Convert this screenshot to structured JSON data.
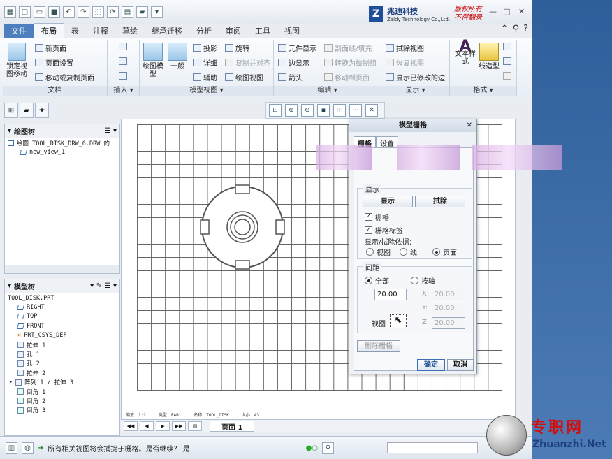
{
  "logo": {
    "mark": "Z",
    "name": "兆迪科技",
    "en": "Zaldy Technology Co.,Ltd.",
    "red1": "版权所有",
    "red2": "不得翻录"
  },
  "tabs": [
    "文件",
    "布局",
    "表",
    "注释",
    "草绘",
    "继承迁移",
    "分析",
    "审阅",
    "工具",
    "视图"
  ],
  "ribbon": {
    "doc": {
      "big": "锁定视图移动",
      "items": [
        "新页面",
        "页面设置",
        "移动或复制页面"
      ],
      "label": "文档"
    },
    "insert": {
      "label": "插入"
    },
    "model": {
      "big1": "绘图模型",
      "big2": "一般",
      "items": [
        "投影",
        "详细",
        "辅助",
        "旋转",
        "复制并对齐",
        "绘图视图"
      ],
      "label": "模型视图"
    },
    "edit": {
      "items": [
        "元件显示",
        "边显示",
        "箭头",
        "剖面线/填充",
        "转换为绘制组",
        "移动到页面"
      ],
      "label": "编辑"
    },
    "display": {
      "items": [
        "拭除视图",
        "恢复视图",
        "显示已修改的边"
      ],
      "label": "显示"
    },
    "format": {
      "big1": "文本样式",
      "big2": "线造型",
      "label": "格式"
    }
  },
  "draw_tree": {
    "title": "绘图树",
    "items": [
      "绘图 TOOL_DISK_DRW_6.DRW 的",
      "new_view_1"
    ]
  },
  "model_tree": {
    "title": "模型树",
    "items": [
      "TOOL_DISK.PRT",
      "RIGHT",
      "TOP",
      "FRONT",
      "PRT_CSYS_DEF",
      "拉伸 1",
      "孔 1",
      "孔 2",
      "拉伸 2",
      "阵列 1 / 拉伸 3",
      "倒角 1",
      "倒角 2",
      "倒角 3"
    ]
  },
  "canvas_footer": [
    "缩放：1:2",
    "类型：FAB1",
    "名称：TOOL_DISK",
    "大小：A3"
  ],
  "page_tab": "页面 1",
  "status_msg": "所有相关视图将会捕捉于栅格。是否继续？   是",
  "dialog": {
    "title": "模型栅格",
    "tab1": "栅格",
    "tab2": "设置",
    "show_legend": "显示",
    "show_btn": "显示",
    "erase_btn": "拭除",
    "grid_chk": "栅格",
    "label_chk": "栅格标签",
    "basis": "显示/拭除依据：",
    "r_view": "视图",
    "r_line": "线",
    "r_page": "页面",
    "spacing_legend": "间距",
    "r_all": "全部",
    "r_axis": "按轴",
    "spacing": "20.00",
    "x": "20.00",
    "y": "20.00",
    "z": "20.00",
    "view_label": "视图",
    "del_btn": "删除栅格",
    "ok": "确定",
    "cancel": "取消"
  },
  "watermark": {
    "cn": "专职网",
    "en": "Zhuanzhi.Net"
  }
}
